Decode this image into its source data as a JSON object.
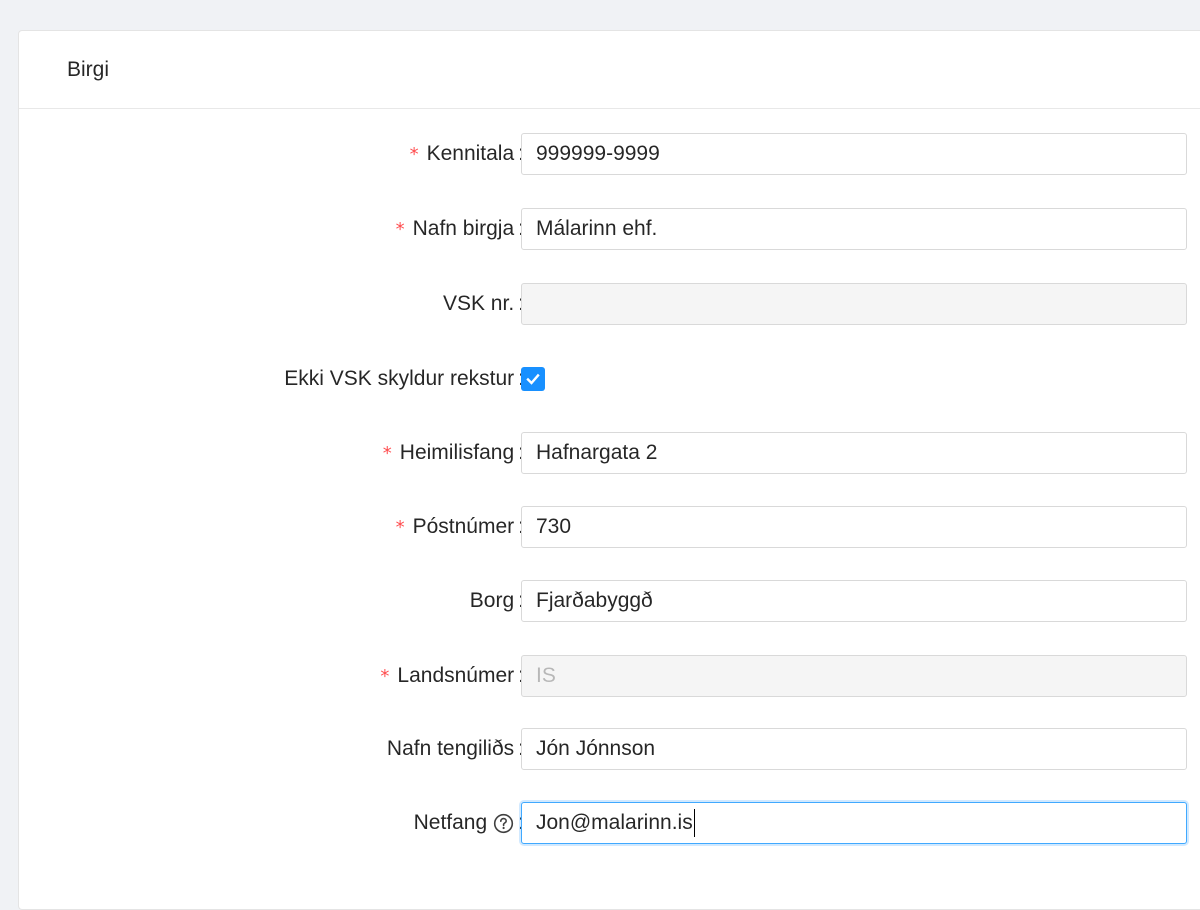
{
  "card": {
    "title": "Birgi"
  },
  "form": {
    "kennitala": {
      "label": "Kennitala",
      "value": "999999-9999",
      "required": true
    },
    "nafn_birgja": {
      "label": "Nafn birgja",
      "value": "Málarinn ehf.",
      "required": true
    },
    "vsk_nr": {
      "label": "VSK nr.",
      "value": "",
      "disabled": true
    },
    "ekki_vsk": {
      "label": "Ekki VSK skyldur rekstur",
      "checked": true
    },
    "heimilisfang": {
      "label": "Heimilisfang",
      "value": "Hafnargata 2",
      "required": true
    },
    "postnumer": {
      "label": "Póstnúmer",
      "value": "730",
      "required": true
    },
    "borg": {
      "label": "Borg",
      "value": "Fjarðabyggð"
    },
    "landsnumer": {
      "label": "Landsnúmer",
      "value": "IS",
      "required": true,
      "disabled": true
    },
    "nafn_tengilids": {
      "label": "Nafn tengiliðs",
      "value": "Jón Jónnson"
    },
    "netfang": {
      "label": "Netfang",
      "value": "Jon@malarinn.is",
      "help_icon": "question-circle-icon",
      "focused": true
    }
  },
  "colors": {
    "required": "#ff4d4f",
    "primary": "#1890ff",
    "focus_border": "#40a9ff",
    "disabled_bg": "#f5f5f5"
  },
  "symbols": {
    "required_mark": "*",
    "colon": ":"
  }
}
